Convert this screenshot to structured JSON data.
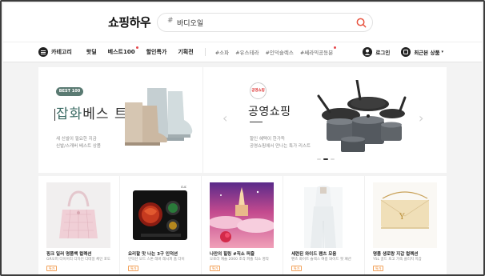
{
  "header": {
    "logo": "쇼핑하우",
    "search": {
      "prefix_mark": "#",
      "value": "바디오일"
    }
  },
  "nav": {
    "category_label": "카테고리",
    "items": [
      {
        "label": "핫딜",
        "new": false
      },
      {
        "label": "베스트100",
        "new": true
      },
      {
        "label": "할인특가",
        "new": false
      },
      {
        "label": "기획전",
        "new": false
      }
    ],
    "tags": [
      {
        "label": "#소파",
        "new": false
      },
      {
        "label": "#유스테라",
        "new": false
      },
      {
        "label": "#인덕슬렉스",
        "new": false
      },
      {
        "label": "#쎄라믹공동분",
        "new": true
      }
    ],
    "login_label": "로그인",
    "recent_label": "최근본 상품"
  },
  "banner_left": {
    "badge": "BEST 100",
    "title_accent": "잡화",
    "title_rest": "베스 트",
    "subtitle_lines": [
      "새 신발이 필요한 지금",
      "신발/스캐버 베스트 상품"
    ]
  },
  "banner_right": {
    "brand": "공영쇼핑",
    "title": "공영쇼핑",
    "subtitle_lines": [
      "할인 혜택이 한가득",
      "공영쇼핑에서 만나는 특가 리스트"
    ]
  },
  "products": [
    {
      "title": "핑크 일러 명품백 컬렉션",
      "desc": "GR오피 다이어리 디자인 디테일 체인 포도",
      "tag": "특가"
    },
    {
      "title": "요리할 맛 나는 3구 인덕션",
      "desc": "인덕션 모드 스톤 레버 레시피 홈 다이",
      "tag": "특가"
    },
    {
      "title": "나만의 힐링 #직소 퍼즐",
      "desc": "오로라 캐슬 2000 조각 퍼즐 직소 명작",
      "tag": "특가"
    },
    {
      "title": "세련된 와이드 팬츠 모음",
      "desc": "팬츠 화이트 슬랙스 여름 와이드 핏 패션",
      "tag": "특가"
    },
    {
      "title": "명품 생로랑 지갑 컬렉션",
      "desc": "YSL 골드 로고 가죽 클러치 지갑",
      "tag": "특가"
    }
  ],
  "colors": {
    "accent_teal": "#3b6b64",
    "new_dot": "#e5484d",
    "tag_orange": "#f0872a"
  }
}
